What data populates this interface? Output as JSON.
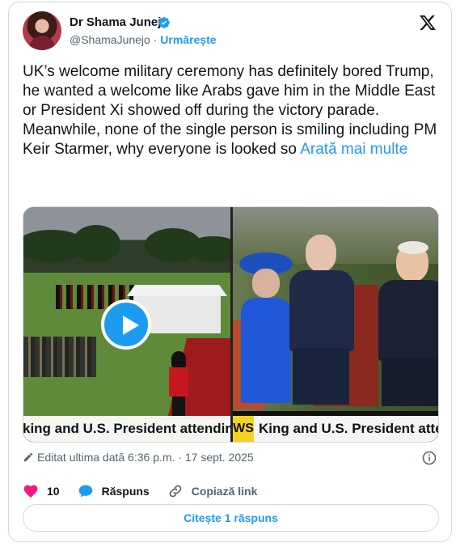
{
  "author": {
    "name": "Dr Shama Junejo",
    "handle": "@ShamaJunejo",
    "separator": "·",
    "follow_label": "Urmărește"
  },
  "tweet": {
    "text": "UK’s welcome military ceremony has definitely bored Trump, he wanted a welcome like Arabs gave him in the Middle East or President Xi showed off during the victory parade.\nMeanwhile, none of the single person is smiling including PM Keir Starmer, why everyone is looked so ",
    "show_more": "Arată mai multe"
  },
  "media": {
    "left_caption": "king and U.S. President attending",
    "right_tag": "WS",
    "right_caption": "King and U.S. President attending"
  },
  "meta": {
    "edited_label": "Editat ultima dată 6:36 p.m. · 17 sept. 2025"
  },
  "actions": {
    "like_count": "10",
    "reply_label": "Răspuns",
    "copy_link_label": "Copiază link"
  },
  "read_replies_label": "Citește 1 răspuns",
  "colors": {
    "accent": "#1d9bf0",
    "like": "#f91880",
    "text": "#0f1419",
    "muted": "#536471",
    "border": "#cfd9de"
  },
  "icons": [
    "verified-badge-icon",
    "x-logo-icon",
    "play-icon",
    "pencil-icon",
    "info-icon",
    "heart-icon",
    "reply-bubble-icon",
    "link-icon"
  ]
}
